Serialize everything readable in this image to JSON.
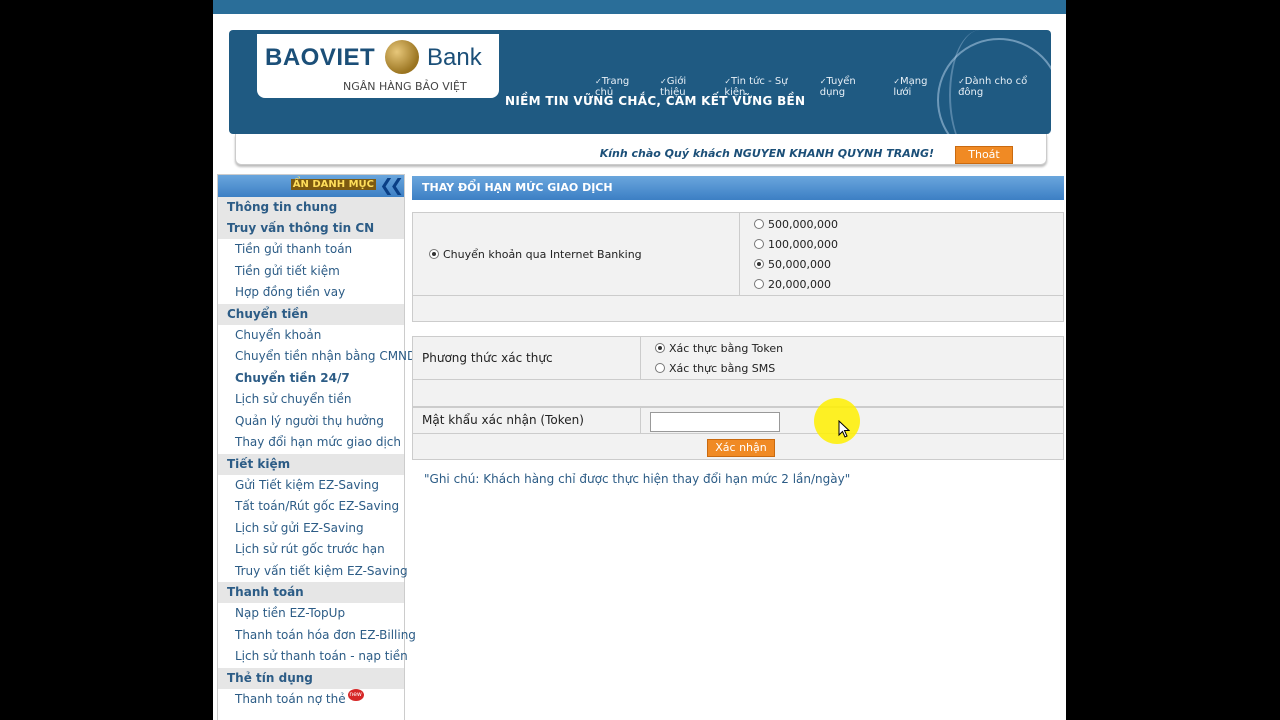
{
  "brand": {
    "name": "BAOVIET",
    "bank": "Bank",
    "subtitle": "NGÂN HÀNG BẢO VIỆT",
    "slogan": "NIỀM TIN VỮNG CHẮC, CAM KẾT VỮNG BỀN"
  },
  "topnav": [
    "Trang chủ",
    "Giới thiệu",
    "Tin tức - Sự kiện",
    "Tuyển dụng",
    "Mạng lưới",
    "Dành cho cổ đông"
  ],
  "welcome": "Kính chào Quý khách NGUYEN KHANH QUYNH TRANG!",
  "logout": "Thoát",
  "sidebar": {
    "collapse": "ẨN DANH MỤC",
    "sections": [
      {
        "title": "Thông tin chung",
        "items": []
      },
      {
        "title": "Truy vấn thông tin CN",
        "items": [
          "Tiền gửi thanh toán",
          "Tiền gửi tiết kiệm",
          "Hợp đồng tiền vay"
        ]
      },
      {
        "title": "Chuyển tiền",
        "items": [
          "Chuyển khoản",
          "Chuyển tiền nhận bằng CMND",
          "Chuyển tiền 24/7",
          "Lịch sử chuyển tiền",
          "Quản lý người thụ hưởng",
          "Thay đổi hạn mức giao dịch"
        ]
      },
      {
        "title": "Tiết kiệm",
        "items": [
          "Gửi Tiết kiệm EZ-Saving",
          "Tất toán/Rút gốc EZ-Saving",
          "Lịch sử gửi EZ-Saving",
          "Lịch sử rút gốc trước hạn",
          "Truy vấn tiết kiệm EZ-Saving"
        ]
      },
      {
        "title": "Thanh toán",
        "items": [
          "Nạp tiền EZ-TopUp",
          "Thanh toán hóa đơn EZ-Billing",
          "Lịch sử thanh toán - nạp tiền"
        ]
      },
      {
        "title": "Thẻ tín dụng",
        "items": [
          "Thanh toán nợ thẻ"
        ]
      }
    ],
    "new_badge": "new"
  },
  "main": {
    "title": "THAY ĐỔI HẠN MỨC GIAO DỊCH",
    "transfer_option": "Chuyển khoản qua Internet Banking",
    "limits": [
      "500,000,000",
      "100,000,000",
      "50,000,000",
      "20,000,000"
    ],
    "selected_limit": "50,000,000",
    "auth_label": "Phương thức xác thực",
    "auth_options": [
      "Xác thực bằng Token",
      "Xác thực bằng SMS"
    ],
    "selected_auth": "Xác thực bằng Token",
    "token_label": "Mật khẩu xác nhận (Token)",
    "token_value": "",
    "confirm": "Xác nhận",
    "note": "\"Ghi chú: Khách hàng chỉ được thực hiện thay đổi hạn mức 2 lần/ngày\""
  }
}
